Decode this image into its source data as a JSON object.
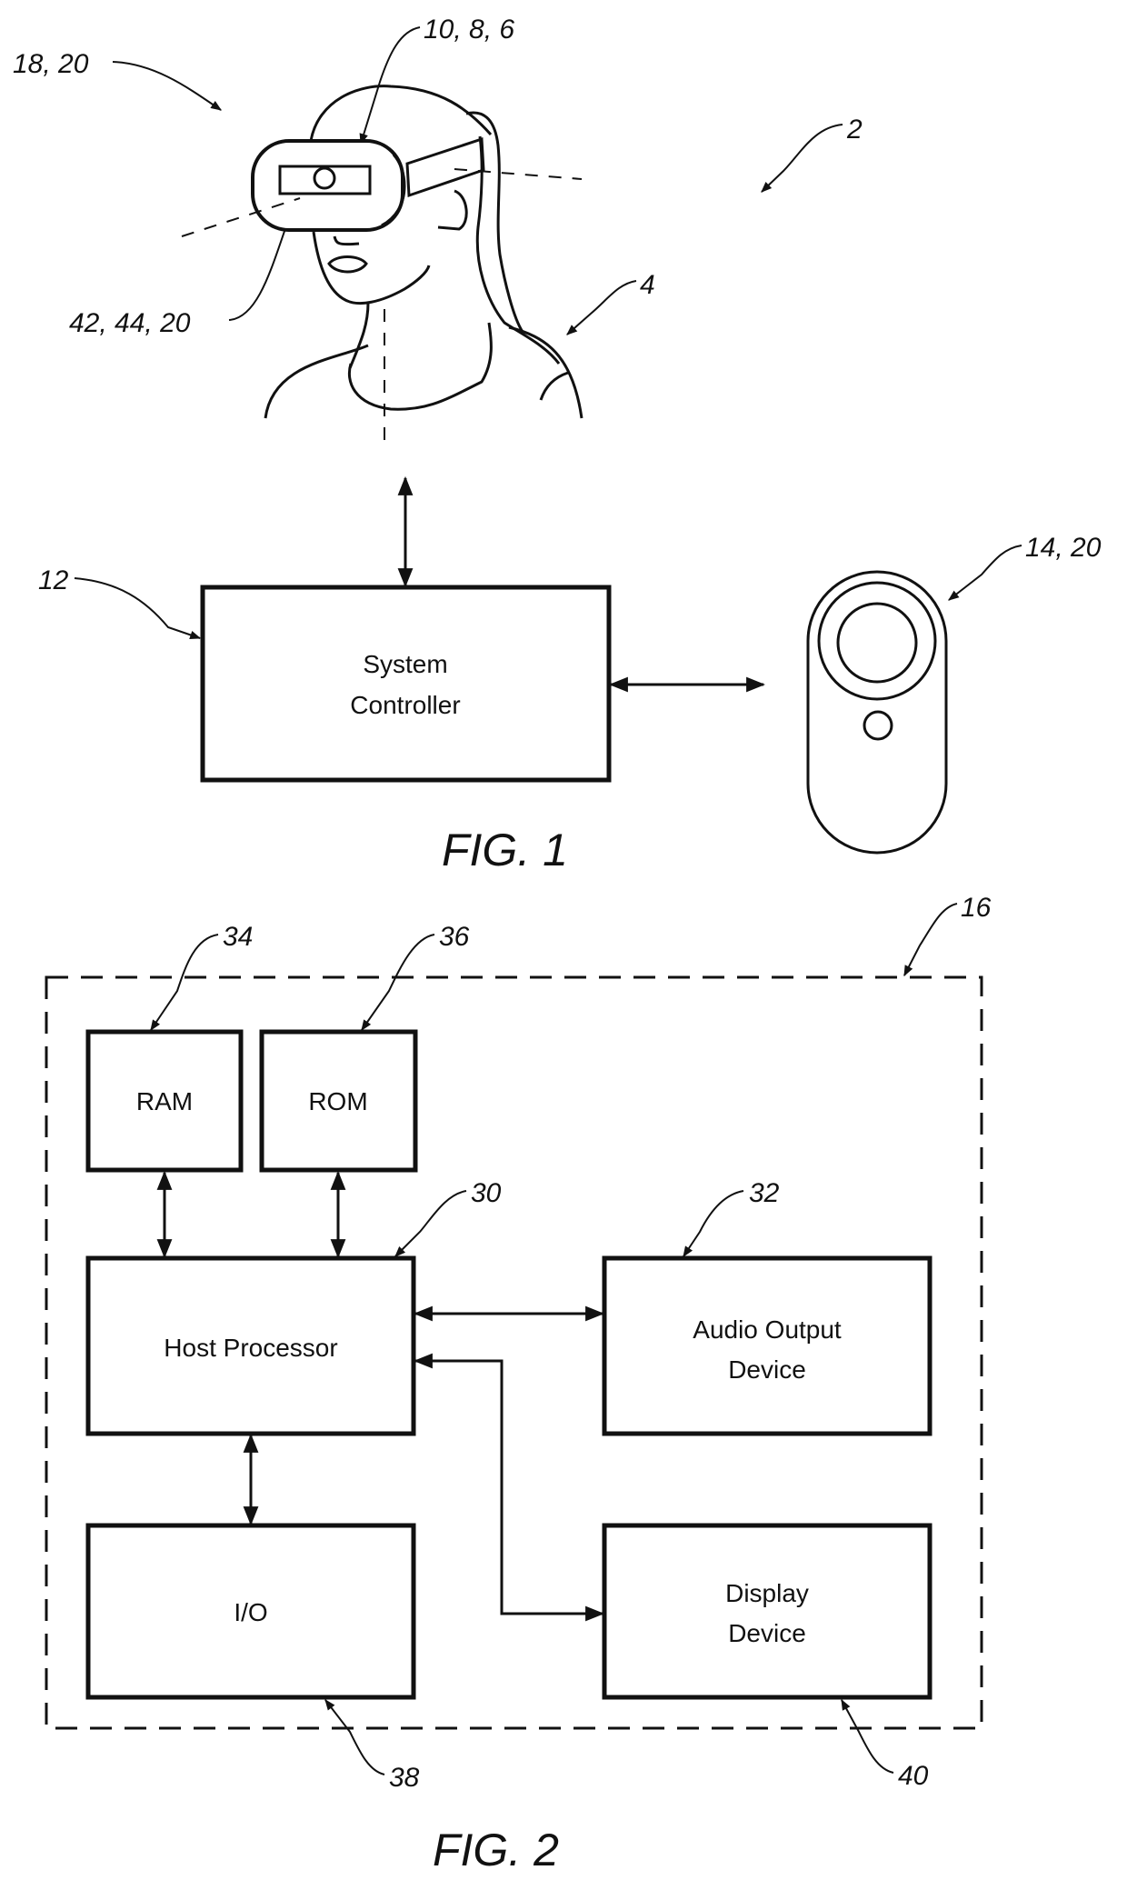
{
  "figures": {
    "fig1": {
      "caption": "FIG. 1",
      "refs": {
        "system": "2",
        "user": "4",
        "headset": "10, 8, 6",
        "eye_tracker": "42, 44, 20",
        "sensors": "18, 20",
        "controller_ref": "12",
        "handheld": "14, 20"
      },
      "system_controller": {
        "line1": "System",
        "line2": "Controller"
      }
    },
    "fig2": {
      "caption": "FIG. 2",
      "refs": {
        "enclosure": "16",
        "ram": "34",
        "rom": "36",
        "host": "30",
        "audio": "32",
        "io": "38",
        "display": "40"
      },
      "blocks": {
        "ram": "RAM",
        "rom": "ROM",
        "host": "Host Processor",
        "audio_line1": "Audio Output",
        "audio_line2": "Device",
        "io": "I/O",
        "display_line1": "Display",
        "display_line2": "Device"
      }
    }
  },
  "colors": {
    "ink": "#111111",
    "paper": "#ffffff"
  }
}
